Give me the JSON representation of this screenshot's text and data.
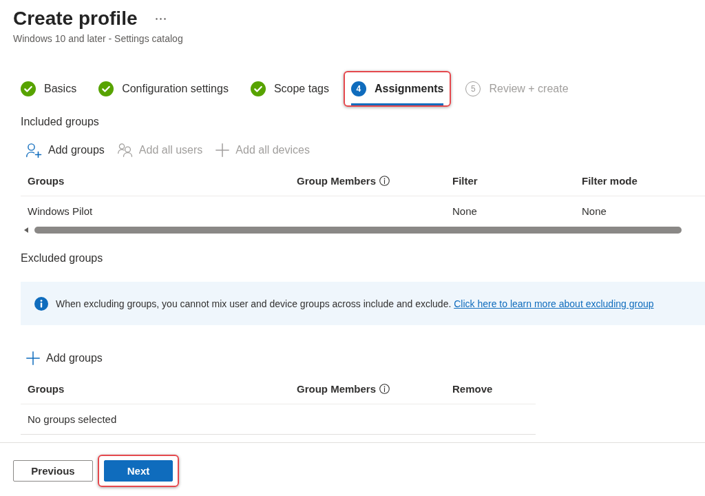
{
  "header": {
    "title": "Create profile",
    "subtitle": "Windows 10 and later - Settings catalog"
  },
  "wizard_steps": [
    {
      "label": "Basics",
      "kind": "completed",
      "selected": false,
      "highlighted": false
    },
    {
      "label": "Configuration settings",
      "kind": "completed",
      "selected": false,
      "highlighted": false
    },
    {
      "label": "Scope tags",
      "kind": "completed",
      "selected": false,
      "highlighted": false
    },
    {
      "label": "Assignments",
      "number": "4",
      "kind": "current",
      "selected": true,
      "highlighted": true
    },
    {
      "label": "Review + create",
      "number": "5",
      "kind": "pending",
      "selected": false,
      "highlighted": false
    }
  ],
  "included_groups": {
    "heading": "Included groups",
    "toolbar": [
      {
        "label": "Add groups",
        "kind": "group",
        "disabled": false
      },
      {
        "label": "Add all users",
        "kind": "users",
        "disabled": true
      },
      {
        "label": "Add all devices",
        "kind": "devices",
        "disabled": true
      }
    ],
    "table": {
      "columns": [
        {
          "label": "Groups",
          "info": false
        },
        {
          "label": "Group Members",
          "info": true
        },
        {
          "label": "Filter",
          "info": false
        },
        {
          "label": "Filter mode",
          "info": false
        }
      ],
      "rows": [
        {
          "groups": "Windows Pilot",
          "filter": "None",
          "filter_mode": "None"
        }
      ]
    }
  },
  "excluded_groups": {
    "heading": "Excluded groups",
    "notice": {
      "text": "When excluding groups, you cannot mix user and device groups across include and exclude.",
      "link": "Click here to learn more about excluding group"
    },
    "toolbar": [
      {
        "label": "Add groups",
        "kind": "exclusion",
        "disabled": false
      }
    ],
    "table": {
      "columns": [
        {
          "label": "Groups",
          "info": false
        },
        {
          "label": "Group Members",
          "info": true
        },
        {
          "label": "Remove",
          "info": false
        }
      ],
      "empty_message": "No groups selected"
    }
  },
  "footer": {
    "buttons": [
      {
        "label": "Previous",
        "kind": "secondary",
        "highlighted": false
      },
      {
        "label": "Next",
        "kind": "primary",
        "highlighted": true
      }
    ]
  }
}
